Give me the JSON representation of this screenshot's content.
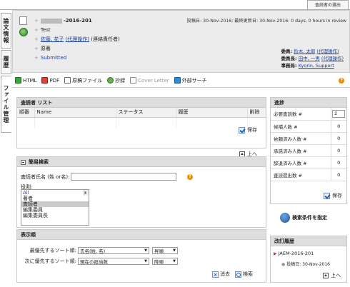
{
  "top_tab": "査読者の選出",
  "left_tabs": [
    "論文情報",
    "履歴",
    "ファイル管理"
  ],
  "header": {
    "manuscript_id_suffix": "-2016-201",
    "title": "Test",
    "author_name": "佐藤, 花子",
    "author_role": "(代理操作)",
    "author_note": "(連絡責任者)",
    "type": "原著",
    "status": "Submitted",
    "dates": "投稿日: 30-Nov-2016; 最終更新日: 30-Nov-2016: 0 days, 0 hours in review",
    "editors": [
      {
        "label": "委員:",
        "name": "鈴木, 太郎",
        "role": "(代理操作)"
      },
      {
        "label": "委員長:",
        "name": "田中, 一男",
        "role": "(代理操作)"
      },
      {
        "label": "事務局:",
        "name": "Kyorin, Support",
        "role": ""
      }
    ]
  },
  "toolbar": {
    "html": "HTML",
    "pdf": "PDF",
    "original_file": "原稿ファイル",
    "approve": "抄録",
    "cover_letter": "Cover Letter",
    "external_search": "外部サーチ"
  },
  "reviewer_list": {
    "title": "査読者 リスト",
    "columns": [
      "順番",
      "Name",
      "ステータス",
      "履歴",
      "削除"
    ],
    "save": "保存",
    "up": "上へ"
  },
  "simple_search": {
    "title": "簡易検索",
    "name_label": "査読者氏名 (姓 or名):",
    "name_value": "",
    "role_label": "役割:",
    "roles": [
      "All",
      "著者",
      "査読者",
      "編集委員",
      "編集委員長"
    ],
    "selected_role": "査読者"
  },
  "sort": {
    "title": "表示順",
    "rows": [
      {
        "label": "最優先するソート順:",
        "field": "氏名(姓, 名)",
        "order": "昇順"
      },
      {
        "label": "次に優先するソート順:",
        "field": "現在の担当数",
        "order": "降順"
      }
    ],
    "clear": "消去",
    "search": "検索"
  },
  "progress": {
    "title": "進捗",
    "rows": [
      {
        "label": "必要査読数 #",
        "value": "2"
      },
      {
        "label": "候補人数 #",
        "value": "0"
      },
      {
        "label": "依頼済み人数 #",
        "value": "0"
      },
      {
        "label": "承諾済み人数 #",
        "value": "0"
      },
      {
        "label": "辞退済み人数 #",
        "value": "0"
      },
      {
        "label": "査読提出数 #",
        "value": "0"
      }
    ],
    "save": "保存"
  },
  "specify_search": "検索条件を指定",
  "history": {
    "title": "改訂履歴",
    "item": "JAEM-2016-201",
    "sub": "投稿日: 30-Nov-2016",
    "up": "上へ"
  }
}
